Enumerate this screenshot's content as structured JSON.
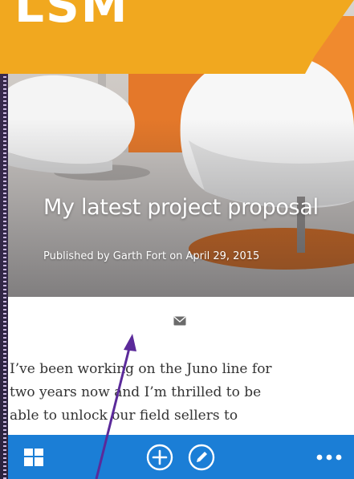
{
  "banner": {
    "text": "LSM"
  },
  "article": {
    "title": "My latest project proposal",
    "meta": "Published by Garth Fort on April 29, 2015",
    "body_lines": [
      "I’ve been working on the Juno line for",
      "two years now and I’m thrilled to be",
      "able to unlock our field sellers to"
    ]
  },
  "appbar": {
    "buttons": [
      {
        "name": "home-icon"
      },
      {
        "name": "add-icon"
      },
      {
        "name": "edit-icon"
      },
      {
        "name": "more-icon"
      }
    ]
  },
  "colors": {
    "banner": "#f1a81f",
    "appbar": "#1b7ed6",
    "arrow": "#5b2a9a"
  }
}
